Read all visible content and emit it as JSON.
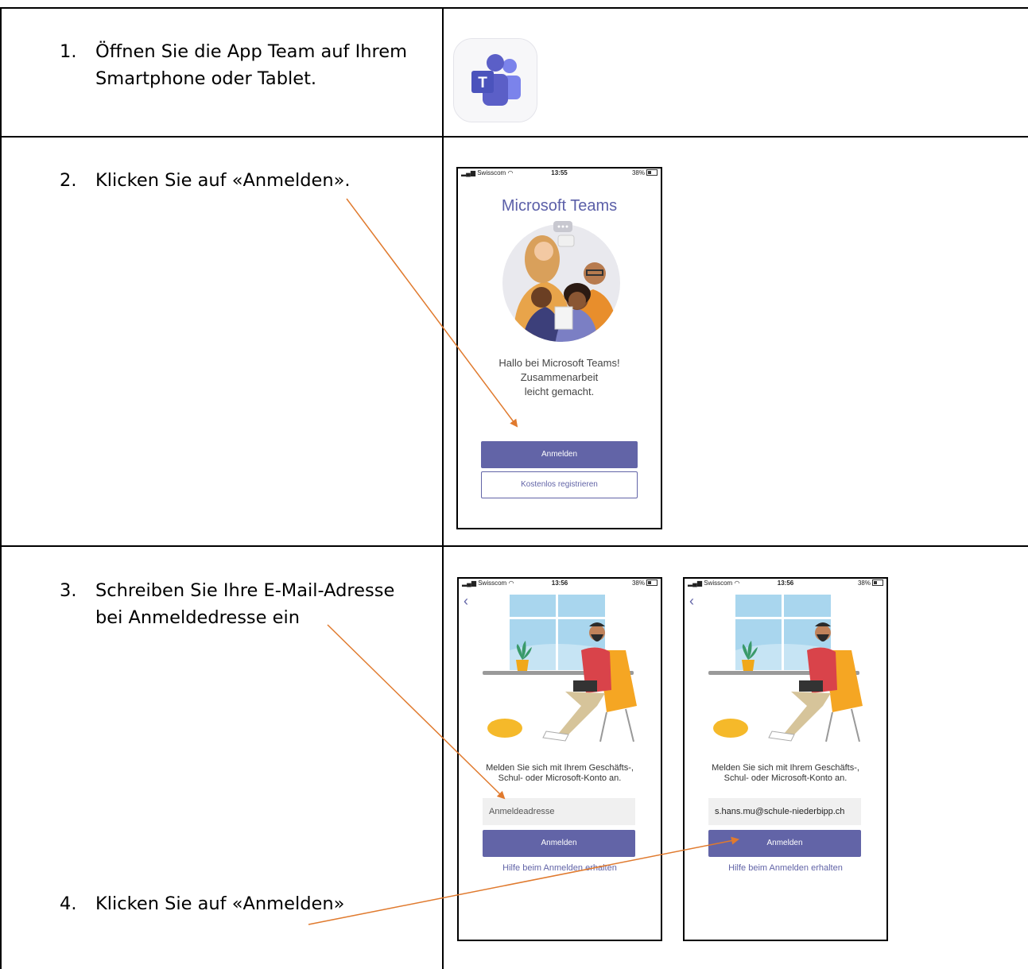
{
  "steps": [
    {
      "number": "1.",
      "line1": "Öffnen Sie die App Team auf Ihrem",
      "line2": "Smartphone oder Tablet."
    },
    {
      "number": "2.",
      "line1": "Klicken Sie auf «Anmelden»."
    },
    {
      "number": "3.",
      "line1": "Schreiben Sie Ihre E-Mail-Adresse",
      "line2": "bei Anmeldedresse ein"
    },
    {
      "number": "4.",
      "line1": "Klicken Sie auf «Anmelden»"
    }
  ],
  "app_icon": {
    "name": "microsoft-teams-app-icon",
    "color": "#5b5fc7"
  },
  "phone_welcome": {
    "status": {
      "carrier": "Swisscom",
      "time": "13:55",
      "battery": "38%"
    },
    "title": "Microsoft Teams",
    "welcome_line1": "Hallo bei Microsoft Teams!",
    "welcome_line2": "Zusammenarbeit",
    "welcome_line3": "leicht gemacht.",
    "signin_button": "Anmelden",
    "register_button": "Kostenlos registrieren"
  },
  "phone_signin_empty": {
    "status": {
      "carrier": "Swisscom",
      "time": "13:56",
      "battery": "38%"
    },
    "back_icon": "chevron-left-icon",
    "text_line1": "Melden Sie sich mit Ihrem Geschäfts-,",
    "text_line2": "Schul- oder Microsoft-Konto an.",
    "input_placeholder": "Anmeldeadresse",
    "signin_button": "Anmelden",
    "help_link": "Hilfe beim Anmelden erhalten"
  },
  "phone_signin_filled": {
    "status": {
      "carrier": "Swisscom",
      "time": "13:56",
      "battery": "38%"
    },
    "back_icon": "chevron-left-icon",
    "text_line1": "Melden Sie sich mit Ihrem Geschäfts-,",
    "text_line2": "Schul- oder Microsoft-Konto an.",
    "input_value": "s.hans.mu@schule-niederbipp.ch",
    "signin_button": "Anmelden",
    "help_link": "Hilfe beim Anmelden erhalten"
  },
  "colors": {
    "teams_purple": "#6264a7",
    "arrow_orange": "#e07a2e"
  }
}
